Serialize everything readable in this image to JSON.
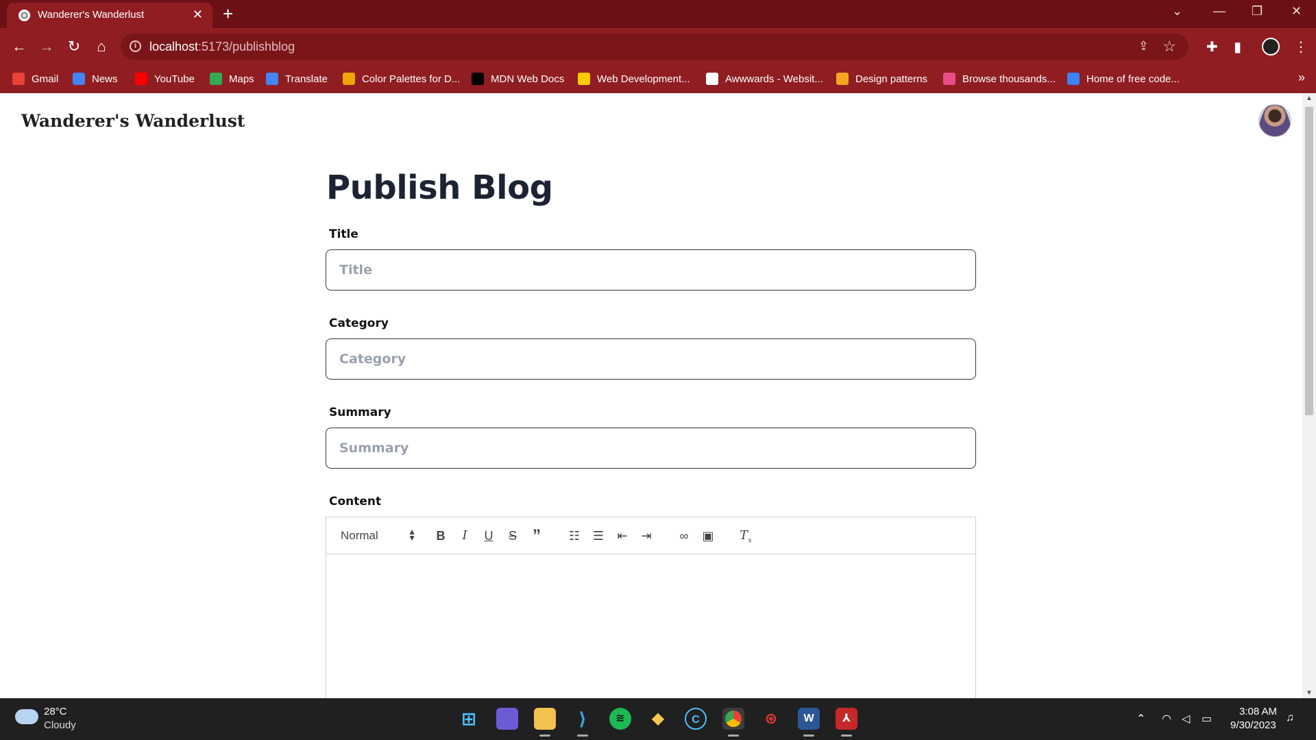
{
  "browser": {
    "tab_title": "Wanderer's Wanderlust",
    "url_host": "localhost",
    "url_path": ":5173/publishblog",
    "bookmarks": [
      {
        "label": "Gmail",
        "icon": "gmail-icon",
        "color": "#ea4335"
      },
      {
        "label": "News",
        "icon": "news-icon",
        "color": "#4285f4"
      },
      {
        "label": "YouTube",
        "icon": "youtube-icon",
        "color": "#ff0000"
      },
      {
        "label": "Maps",
        "icon": "maps-icon",
        "color": "#34a853"
      },
      {
        "label": "Translate",
        "icon": "translate-icon",
        "color": "#4285f4"
      },
      {
        "label": "Color Palettes for D...",
        "icon": "palette-icon",
        "color": "#f0a500"
      },
      {
        "label": "MDN Web Docs",
        "icon": "mdn-icon",
        "color": "#000000"
      },
      {
        "label": "Web Development...",
        "icon": "webdev-icon",
        "color": "#ffcc00"
      },
      {
        "label": "Awwwards - Websit...",
        "icon": "awwwards-icon",
        "color": "#ffffff"
      },
      {
        "label": "Design patterns",
        "icon": "design-patterns-icon",
        "color": "#f5a623"
      },
      {
        "label": "Browse thousands...",
        "icon": "dribbble-icon",
        "color": "#ea4c89"
      },
      {
        "label": "Home of free code...",
        "icon": "code-icon",
        "color": "#3b82f6"
      }
    ]
  },
  "site": {
    "title": "Wanderer's Wanderlust"
  },
  "form": {
    "heading": "Publish Blog",
    "title_label": "Title",
    "title_placeholder": "Title",
    "category_label": "Category",
    "category_placeholder": "Category",
    "summary_label": "Summary",
    "summary_placeholder": "Summary",
    "content_label": "Content",
    "editor_header_value": "Normal"
  },
  "taskbar": {
    "temperature": "28°C",
    "condition": "Cloudy",
    "time": "3:08 AM",
    "date": "9/30/2023"
  },
  "theme": {
    "chrome_dark": "#6b1115",
    "chrome": "#8f1d22",
    "heading_color": "#1c2433"
  }
}
